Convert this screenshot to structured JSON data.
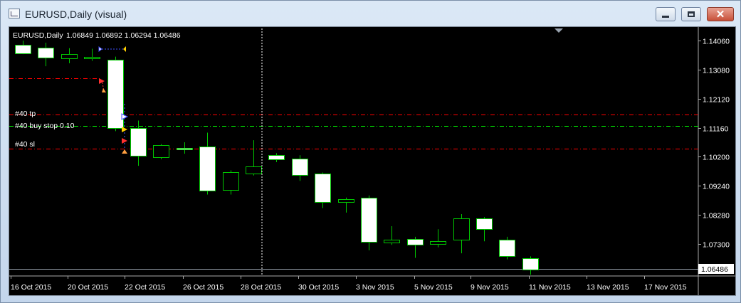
{
  "window": {
    "title": "EURUSD,Daily (visual)",
    "minimize_label": "minimize",
    "maximize_label": "maximize",
    "close_label": "close"
  },
  "chart": {
    "symbol_label": "EURUSD,Daily",
    "ohlc_text": "1.06849 1.06892 1.06294 1.06486",
    "current_price": "1.06486",
    "price_axis_labels": [
      "1.14060",
      "1.13080",
      "1.12120",
      "1.11160",
      "1.10200",
      "1.09240",
      "1.08280",
      "1.07300"
    ],
    "time_axis_labels": [
      "16 Oct 2015",
      "20 Oct 2015",
      "22 Oct 2015",
      "26 Oct 2015",
      "28 Oct 2015",
      "30 Oct 2015",
      "3 Nov 2015",
      "5 Nov 2015",
      "9 Nov 2015",
      "11 Nov 2015",
      "13 Nov 2015",
      "17 Nov 2015"
    ],
    "order_labels": {
      "tp": "#40 tp",
      "buy_stop": "#40 buy stop 0.10",
      "sl": "#40 sl"
    },
    "colors": {
      "background": "#000000",
      "candle_body": "#ffffff",
      "wick": "#00c800",
      "tp_sl_line": "#ff0000",
      "entry_line": "#00ff00",
      "axis_text": "#ffffff"
    }
  },
  "chart_data": {
    "type": "candlestick",
    "title": "EURUSD,Daily",
    "ylim": [
      1.0625,
      1.145
    ],
    "grid": false,
    "series": [
      {
        "name": "EURUSD",
        "candles": [
          {
            "o": 1.139,
            "h": 1.1405,
            "l": 1.136,
            "c": 1.1362
          },
          {
            "o": 1.1382,
            "h": 1.1398,
            "l": 1.132,
            "c": 1.135
          },
          {
            "o": 1.1345,
            "h": 1.138,
            "l": 1.133,
            "c": 1.136
          },
          {
            "o": 1.1348,
            "h": 1.1378,
            "l": 1.1338,
            "c": 1.1352
          },
          {
            "o": 1.1342,
            "h": 1.1352,
            "l": 1.1105,
            "c": 1.1115
          },
          {
            "o": 1.1115,
            "h": 1.114,
            "l": 1.099,
            "c": 1.1022
          },
          {
            "o": 1.1018,
            "h": 1.1062,
            "l": 1.1012,
            "c": 1.1058
          },
          {
            "o": 1.105,
            "h": 1.1068,
            "l": 1.103,
            "c": 1.1048
          },
          {
            "o": 1.1055,
            "h": 1.11,
            "l": 1.0895,
            "c": 1.0908
          },
          {
            "o": 1.0908,
            "h": 1.0975,
            "l": 1.0895,
            "c": 1.0968
          },
          {
            "o": 1.0965,
            "h": 1.1075,
            "l": 1.0958,
            "c": 1.0988
          },
          {
            "o": 1.1025,
            "h": 1.1032,
            "l": 1.1002,
            "c": 1.1012
          },
          {
            "o": 1.1015,
            "h": 1.1025,
            "l": 1.094,
            "c": 1.096
          },
          {
            "o": 1.0965,
            "h": 1.0968,
            "l": 1.085,
            "c": 1.087
          },
          {
            "o": 1.087,
            "h": 1.0885,
            "l": 1.0835,
            "c": 1.088
          },
          {
            "o": 1.0885,
            "h": 1.0892,
            "l": 1.071,
            "c": 1.074
          },
          {
            "o": 1.0735,
            "h": 1.079,
            "l": 1.0728,
            "c": 1.0745
          },
          {
            "o": 1.0748,
            "h": 1.0755,
            "l": 1.0685,
            "c": 1.0728
          },
          {
            "o": 1.073,
            "h": 1.078,
            "l": 1.072,
            "c": 1.074
          },
          {
            "o": 1.0745,
            "h": 1.083,
            "l": 1.07,
            "c": 1.0815
          },
          {
            "o": 1.0815,
            "h": 1.082,
            "l": 1.074,
            "c": 1.078
          },
          {
            "o": 1.0745,
            "h": 1.0755,
            "l": 1.068,
            "c": 1.069
          },
          {
            "o": 1.0685,
            "h": 1.069,
            "l": 1.0629,
            "c": 1.0648
          }
        ]
      }
    ],
    "levels": [
      {
        "name": "#40 tp",
        "value": 1.116
      },
      {
        "name": "#40 buy stop 0.10",
        "value": 1.1122
      },
      {
        "name": "#40 sl",
        "value": 1.1046
      },
      {
        "name": "current",
        "value": 1.06486
      }
    ],
    "price_ticks": [
      1.1406,
      1.1308,
      1.1212,
      1.1116,
      1.102,
      1.0924,
      1.0828,
      1.073
    ],
    "time_ticks": [
      "16 Oct 2015",
      "20 Oct 2015",
      "22 Oct 2015",
      "26 Oct 2015",
      "28 Oct 2015",
      "30 Oct 2015",
      "3 Nov 2015",
      "5 Nov 2015",
      "9 Nov 2015",
      "11 Nov 2015",
      "13 Nov 2015",
      "17 Nov 2015"
    ]
  }
}
